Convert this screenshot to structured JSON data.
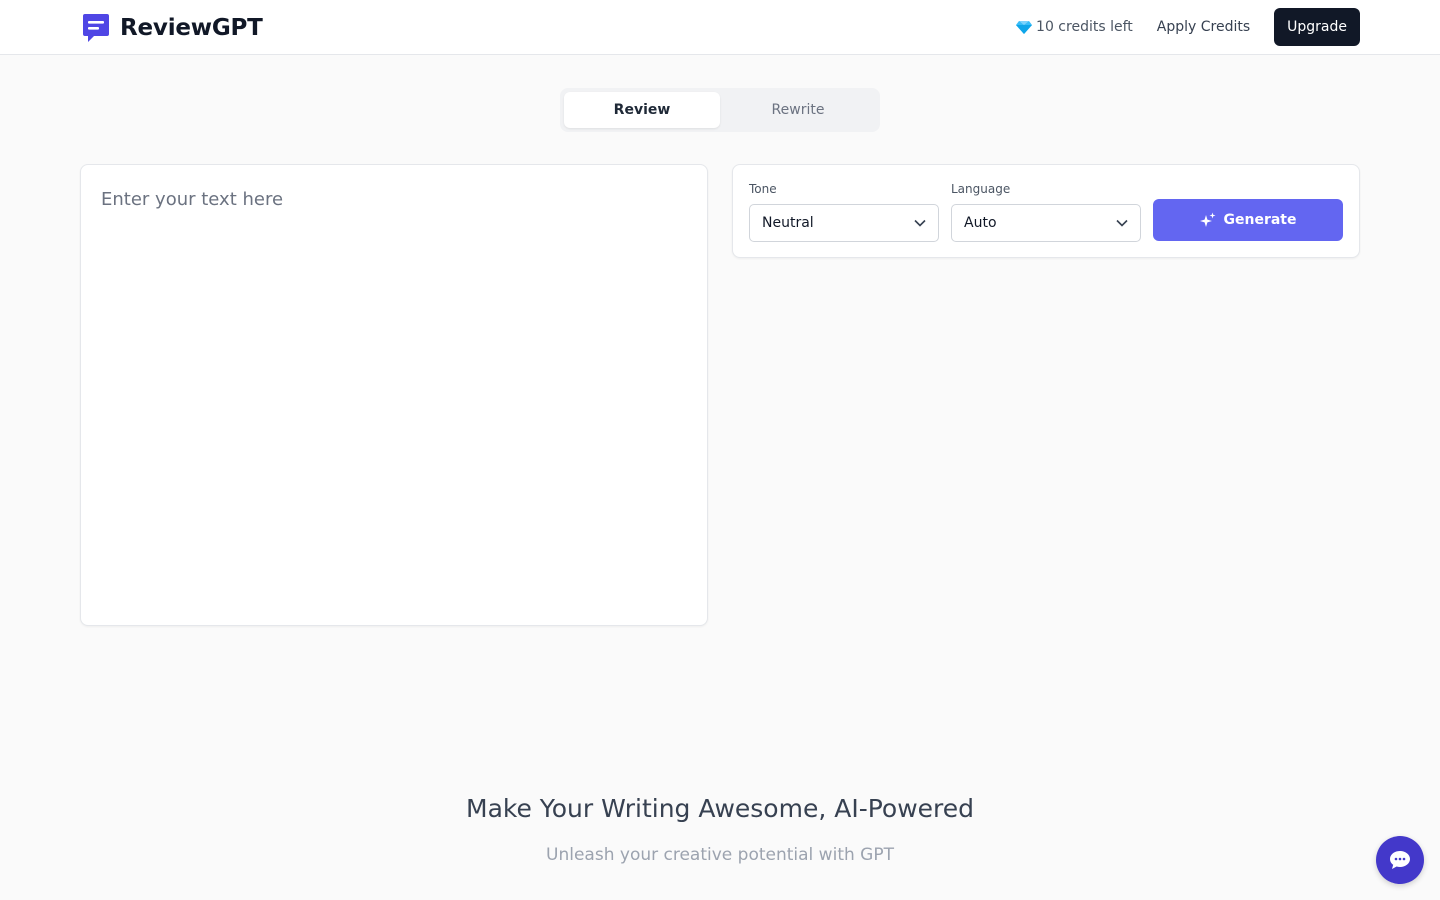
{
  "header": {
    "brand_name": "ReviewGPT",
    "credits_text": "10 credits left",
    "apply_credits_label": "Apply Credits",
    "upgrade_label": "Upgrade"
  },
  "tabs": [
    {
      "label": "Review",
      "active": true
    },
    {
      "label": "Rewrite",
      "active": false
    }
  ],
  "editor": {
    "placeholder": "Enter your text here",
    "value": ""
  },
  "options": {
    "tone_label": "Tone",
    "tone_value": "Neutral",
    "language_label": "Language",
    "language_value": "Auto",
    "generate_label": "Generate"
  },
  "hero": {
    "title": "Make Your Writing Awesome, AI-Powered",
    "subtitle": "Unleash your creative potential with GPT"
  },
  "colors": {
    "accent": "#6366f1",
    "brand_icon": "#4f46e5",
    "dark_button": "#111827",
    "chat_button": "#4338ca"
  },
  "icons": {
    "brand": "chat-square-icon",
    "credits": "gem-icon",
    "select": "chevron-down-icon",
    "generate": "sparkle-icon",
    "chat": "chat-bubble-icon"
  }
}
